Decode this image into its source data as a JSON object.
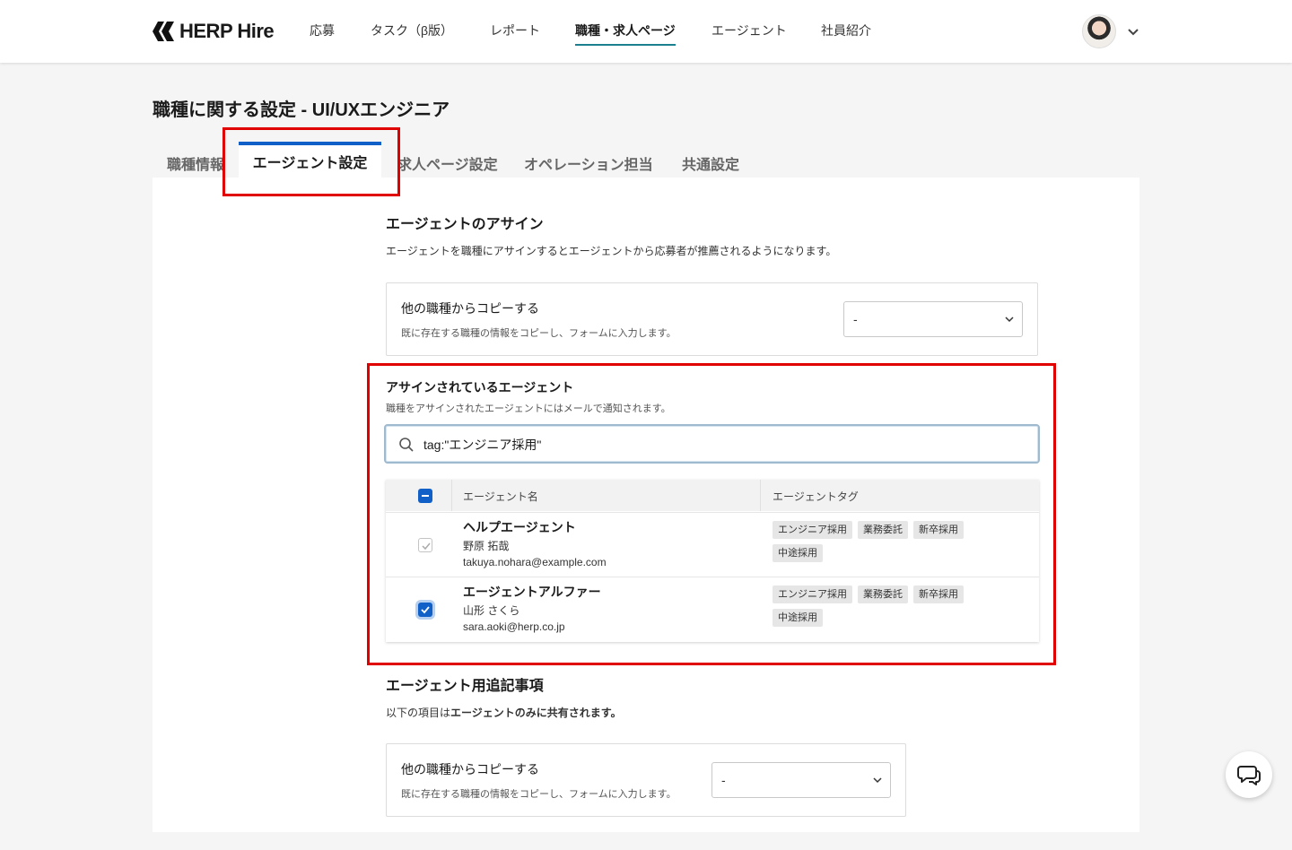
{
  "header": {
    "logo_text": "HERP Hire",
    "nav": [
      {
        "label": "応募"
      },
      {
        "label": "タスク（β版）"
      },
      {
        "label": "レポート"
      },
      {
        "label": "職種・求人ページ",
        "active": true
      },
      {
        "label": "エージェント"
      },
      {
        "label": "社員紹介"
      }
    ]
  },
  "page": {
    "title": "職種に関する設定 - UI/UXエンジニア"
  },
  "tabs": [
    {
      "label": "職種情報"
    },
    {
      "label": "エージェント設定",
      "active": true
    },
    {
      "label": "求人ページ設定"
    },
    {
      "label": "オペレーション担当"
    },
    {
      "label": "共通設定"
    }
  ],
  "assign": {
    "heading": "エージェントのアサイン",
    "description": "エージェントを職種にアサインするとエージェントから応募者が推薦されるようになります。",
    "copy": {
      "title": "他の職種からコピーする",
      "subtitle": "既に存在する職種の情報をコピーし、フォームに入力します。",
      "selected": "-"
    }
  },
  "assigned": {
    "title": "アサインされているエージェント",
    "subtitle": "職種をアサインされたエージェントにはメールで通知されます。",
    "search_value": "tag:\"エンジニア採用\"",
    "columns": {
      "name": "エージェント名",
      "tags": "エージェントタグ"
    },
    "rows": [
      {
        "agent": "ヘルプエージェント",
        "person": "野原 拓哉",
        "email": "takuya.nohara@example.com",
        "tags": [
          "エンジニア採用",
          "業務委託",
          "新卒採用",
          "中途採用"
        ],
        "checked": true,
        "disabled": true
      },
      {
        "agent": "エージェントアルファー",
        "person": "山形 さくら",
        "email": "sara.aoki@herp.co.jp",
        "tags": [
          "エンジニア採用",
          "業務委託",
          "新卒採用",
          "中途採用"
        ],
        "checked": true,
        "disabled": false
      }
    ]
  },
  "notes": {
    "heading": "エージェント用追記事項",
    "description_prefix": "以下の項目は",
    "description_bold": "エージェントのみに共有されます。",
    "copy": {
      "title": "他の職種からコピーする",
      "subtitle": "既に存在する職種の情報をコピーし、フォームに入力します。",
      "selected": "-"
    }
  },
  "colors": {
    "accent": "#1060c8",
    "nav_underline": "#1a7f8e",
    "highlight": "#e00000"
  }
}
